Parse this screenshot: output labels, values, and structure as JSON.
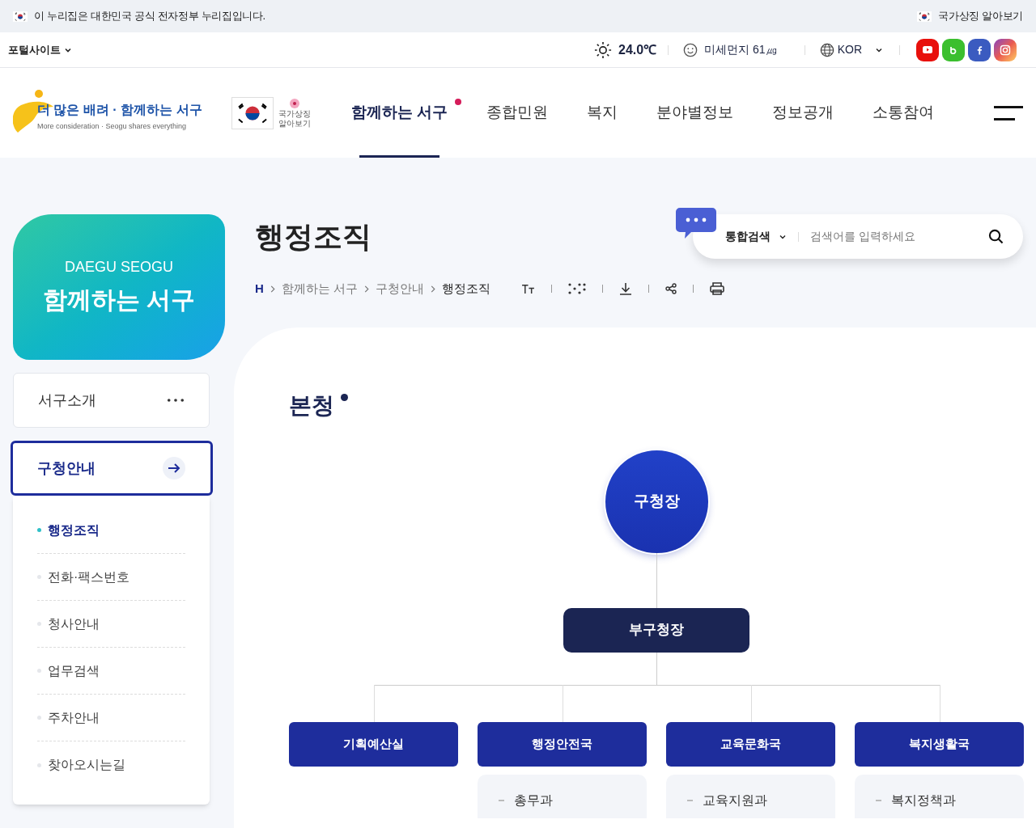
{
  "gov_banner": {
    "text": "이 누리집은 대한민국 공식 전자정부 누리집입니다.",
    "link": "국가상징 알아보기"
  },
  "utility": {
    "portal": "포털사이트",
    "temperature": "24.0℃",
    "dust": "미세먼지 61㎍",
    "language": "KOR"
  },
  "logo": {
    "slogan": "더 많은 배려 · 함께하는 서구",
    "subtitle": "More consideration · Seogu shares everything",
    "symbol_label": "국가상징 알아보기"
  },
  "nav": [
    {
      "label": "함께하는 서구",
      "selected": true
    },
    {
      "label": "종합민원",
      "selected": false
    },
    {
      "label": "복지",
      "selected": false
    },
    {
      "label": "분야별정보",
      "selected": false
    },
    {
      "label": "정보공개",
      "selected": false
    },
    {
      "label": "소통참여",
      "selected": false
    }
  ],
  "side_card": {
    "eyebrow": "DAEGU SEOGU",
    "title": "함께하는 서구"
  },
  "side_menu": [
    {
      "label": "서구소개",
      "expanded": false
    },
    {
      "label": "구청안내",
      "expanded": true,
      "children": [
        {
          "label": "행정조직",
          "selected": true
        },
        {
          "label": "전화·팩스번호",
          "selected": false
        },
        {
          "label": "청사안내",
          "selected": false
        },
        {
          "label": "업무검색",
          "selected": false
        },
        {
          "label": "주차안내",
          "selected": false
        },
        {
          "label": "찾아오시는길",
          "selected": false
        }
      ]
    }
  ],
  "page_title": "행정조직",
  "search": {
    "scope": "통합검색",
    "placeholder": "검색어를 입력하세요"
  },
  "breadcrumb": [
    "H",
    "함께하는 서구",
    "구청안내",
    "행정조직"
  ],
  "section_title": "본청",
  "org": {
    "head": "구청장",
    "deputy": "부구청장",
    "departments": [
      {
        "name": "기획예산실"
      },
      {
        "name": "행정안전국",
        "units": [
          "총무과"
        ]
      },
      {
        "name": "교육문화국",
        "units": [
          "교육지원과"
        ]
      },
      {
        "name": "복지생활국",
        "units": [
          "복지정책과"
        ]
      }
    ]
  }
}
